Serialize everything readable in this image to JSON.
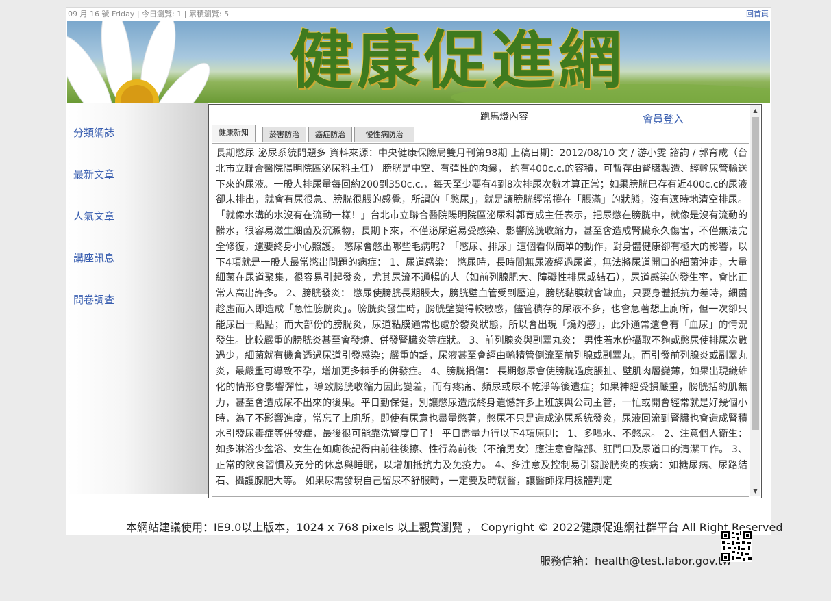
{
  "topbar": {
    "date_stats": "09 月 16 號 Friday | 今日瀏覽: 1 | 累積瀏覽: 5",
    "home_link": "回首頁"
  },
  "banner": {
    "title": "健康促進網"
  },
  "sidebar": {
    "items": [
      {
        "label": "分類網誌"
      },
      {
        "label": "最新文章"
      },
      {
        "label": "人氣文章"
      },
      {
        "label": "講座訊息"
      },
      {
        "label": "問卷調查"
      }
    ]
  },
  "content": {
    "marquee": "跑馬燈內容",
    "login": "會員登入",
    "tabs": [
      {
        "label": "健康新知",
        "active": true
      },
      {
        "label": "菸害防治"
      },
      {
        "label": "癌症防治"
      },
      {
        "label": "慢性病防治"
      }
    ],
    "article": "長期憋尿 泌尿系統問題多 資料來源：中央健康保險局雙月刊第98期 上稿日期：2012/08/10 文 / 游小雯 諮詢 / 郭育成（台北市立聯合醫院陽明院區泌尿科主任） 膀胱是中空、有彈性的肉囊， 約有400c.c.的容積，可暫存由腎臟製造、經輸尿管輸送下來的尿液。一般人排尿量每回約200到350c.c.，每天至少要有4到8次排尿次數才算正常；如果膀胱已存有近400c.c的尿液卻未排出，就會有尿很急、膀胱很脹的感覺，所謂的「憋尿」，就是讓膀胱經常撐在「脹滿」的狀態，沒有適時地清空排尿。「就像水溝的水沒有在流動一樣！」台北市立聯合醫院陽明院區泌尿科郭育成主任表示，把尿憋在膀胱中，就像是沒有流動的髒水，很容易滋生細菌及沉澱物，長期下來，不僅泌尿道易受感染、影響膀胱收縮力，甚至會造成腎臟永久傷害，不僅無法完全修復，還要終身小心照護。 憋尿會憋出哪些毛病呢？「憋尿、排尿」這個看似簡單的動作，對身體健康卻有極大的影響，以下4項就是一般人最常憋出問題的病症： 1、尿道感染： 憋尿時，長時間無尿液經過尿道，無法將尿道開口的細菌沖走，大量細菌在尿道聚集，很容易引起發炎，尤其尿流不通暢的人（如前列腺肥大、障礙性排尿或結石），尿道感染的發生率，會比正常人高出許多。 2、膀胱發炎： 憋尿使膀胱長期脹大，膀胱壁血管受到壓迫，膀胱黏膜就會缺血，只要身體抵抗力差時，細菌趁虛而入即造成「急性膀胱炎」。膀胱炎發生時，膀胱壁變得較敏感，儘管積存的尿液不多，也會急著想上廁所，但一次卻只能尿出一點點；而大部份的膀胱炎，尿道粘膜通常也處於發炎狀態，所以會出現「燒灼感」，此外通常還會有「血尿」的情況發生。比較嚴重的膀胱炎甚至會發燒、併發腎臟炎等症狀。 3、前列腺炎與副睪丸炎： 男性若水份攝取不夠或憋尿使排尿次數過少，細菌就有機會透過尿道引發感染；嚴重的話，尿液甚至會經由輸精管倒流至前列腺或副睪丸，而引發前列腺炎或副睪丸炎，最嚴重可導致不孕，增加更多棘手的併發症。 4、膀胱損傷： 長期憋尿會使膀胱過度脹扯、壁肌肉層變薄，如果出現纖維化的情形會影響彈性，導致膀胱收縮力因此變差，而有疼痛、頻尿或尿不乾淨等後遺症；如果神經受損嚴重，膀胱括約肌無力，甚至會造成尿不出來的後果。平日勤保健，別讓憋尿造成終身遺憾許多上班族與公司主管，一忙或開會經常就是好幾個小時，為了不影響進度，常忘了上廁所，即使有尿意也盡量憋著，憋尿不只是造成泌尿系統發炎，尿液回流到腎臟也會造成腎積水引發尿毒症等併發症，最後很可能靠洗腎度日了！ 平日盡量力行以下4項原則： 1、多喝水、不憋尿。 2、注意個人衛生：如多淋浴少盆浴、女生在如廁後記得由前往後擦、性行為前後（不論男女）應注意會陰部、肛門口及尿道口的清潔工作。 3、正常的飲食習慣及充分的休息與睡眠，以增加抵抗力及免疫力。 4、多注意及控制易引發膀胱炎的疾病：如糖尿病、尿路結石、攝護腺肥大等。 如果尿需發現自己留尿不舒服時，一定要及時就醫，讓醫師採用檢體判定"
  },
  "scroll": {
    "up": "▲",
    "down": "▼",
    "position": 0
  },
  "footer": {
    "notice": "本網站建議使用：IE9.0以上版本，1024 x 768 pixels 以上觀賞瀏覽 ， Copyright © 2022健康促進網社群平台 All Right Reserved",
    "mail": "服務信箱：health@test.labor.gov.tw"
  },
  "colors": {
    "link": "#3a5fb0",
    "background": "#ebebeb",
    "banner_title": "#3f7a1e"
  },
  "icons": {
    "qr": "qr-code-icon",
    "flower": "daisy-flower-image"
  }
}
